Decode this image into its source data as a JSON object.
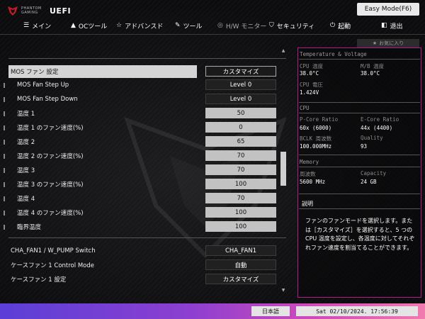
{
  "app": {
    "brand_line1": "PHANTOM",
    "brand_line2": "GAMING",
    "brand_suffix": "UEFI",
    "mode_button": "Easy Mode(F6)",
    "favorites_label": "お気に入り"
  },
  "nav": [
    {
      "label": "メイン",
      "icon": "list-icon"
    },
    {
      "label": "OCツール",
      "icon": "rocket-icon"
    },
    {
      "label": "アドバンスド",
      "icon": "star-icon"
    },
    {
      "label": "ツール",
      "icon": "wrench-icon"
    },
    {
      "label": "H/W モニター",
      "icon": "monitor-icon",
      "active": true
    },
    {
      "label": "セキュリティ",
      "icon": "shield-icon"
    },
    {
      "label": "起動",
      "icon": "power-icon"
    },
    {
      "label": "退出",
      "icon": "exit-icon"
    }
  ],
  "settings": [
    {
      "label": "MOS ファン 設定",
      "value": "カスタマイズ",
      "style": "dark",
      "selected": true
    },
    {
      "label": "MOS Fan Step Up",
      "value": "Level 0",
      "style": "dark"
    },
    {
      "label": "MOS Fan Step Down",
      "value": "Level 0",
      "style": "dark"
    },
    {
      "label": "温度 1",
      "value": "50",
      "style": "light"
    },
    {
      "label": "温度 1 のファン速度(%)",
      "value": "0",
      "style": "light"
    },
    {
      "label": "温度 2",
      "value": "65",
      "style": "light"
    },
    {
      "label": "温度 2 のファン速度(%)",
      "value": "70",
      "style": "light"
    },
    {
      "label": "温度 3",
      "value": "70",
      "style": "light"
    },
    {
      "label": "温度 3 のファン速度(%)",
      "value": "100",
      "style": "light"
    },
    {
      "label": "温度 4",
      "value": "70",
      "style": "light"
    },
    {
      "label": "温度 4 のファン速度(%)",
      "value": "100",
      "style": "light"
    },
    {
      "label": "臨界温度",
      "value": "100",
      "style": "light"
    },
    {
      "label": "CHA_FAN1 / W_PUMP Switch",
      "value": "CHA_FAN1",
      "style": "dark"
    },
    {
      "label": "ケースファン 1 Control Mode",
      "value": "自動",
      "style": "dark"
    },
    {
      "label": "ケースファン 1 設定",
      "value": "カスタマイズ",
      "style": "dark"
    }
  ],
  "monitor": {
    "section1": "Temperature & Voltage",
    "cpu_temp_label": "CPU 温度",
    "cpu_temp_value": "38.0°C",
    "mb_temp_label": "M/B 温度",
    "mb_temp_value": "38.0°C",
    "cpu_volt_label": "CPU 電圧",
    "cpu_volt_value": "1.424V",
    "section2": "CPU",
    "pcore_label": "P-Core Ratio",
    "pcore_value": "60x (6000)",
    "ecore_label": "E-Core Ratio",
    "ecore_value": "44x (4400)",
    "bclk_label": "BCLK 周波数",
    "bclk_value": "100.000MHz",
    "quality_label": "Quality",
    "quality_value": "93",
    "section3": "Memory",
    "freq_label": "周波数",
    "freq_value": "5600 MHz",
    "cap_label": "Capacity",
    "cap_value": "24 GB"
  },
  "help": {
    "title": "説明",
    "text": "ファンのファンモードを選択します。または［カスタマイズ］を選択すると、5 つの CPU 温度を設定し、各温度に対してそれぞれファン速度を割当てることができます。"
  },
  "status": {
    "language": "日本語",
    "datetime": "Sat 02/10/2024. 17:56:39"
  },
  "colors": {
    "accent": "#b21a8e",
    "gradient_start": "#5b3fd6",
    "gradient_end": "#f17ab0"
  }
}
